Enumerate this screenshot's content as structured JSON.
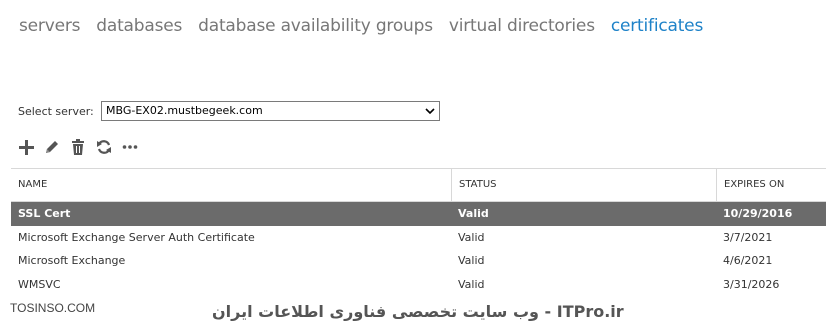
{
  "tabs": [
    {
      "label": "servers",
      "active": false
    },
    {
      "label": "databases",
      "active": false
    },
    {
      "label": "database availability groups",
      "active": false
    },
    {
      "label": "virtual directories",
      "active": false
    },
    {
      "label": "certificates",
      "active": true
    }
  ],
  "server_select": {
    "label": "Select server:",
    "value": "MBG-EX02.mustbegeek.com"
  },
  "toolbar": {
    "icons": [
      "add-icon",
      "edit-icon",
      "delete-icon",
      "refresh-icon",
      "more-icon"
    ]
  },
  "table": {
    "headers": [
      "NAME",
      "STATUS",
      "EXPIRES ON"
    ],
    "rows": [
      {
        "name": "SSL Cert",
        "status": "Valid",
        "expires": "10/29/2016",
        "selected": true
      },
      {
        "name": "Microsoft Exchange Server Auth Certificate",
        "status": "Valid",
        "expires": "3/7/2021",
        "selected": false
      },
      {
        "name": "Microsoft Exchange",
        "status": "Valid",
        "expires": "4/6/2021",
        "selected": false
      },
      {
        "name": "WMSVC",
        "status": "Valid",
        "expires": "3/31/2026",
        "selected": false
      }
    ]
  },
  "watermark": {
    "left": "TOSINSO.COM",
    "right": "ITPro.ir - وب سایت تخصصی فناوری اطلاعات ایران"
  },
  "colors": {
    "accent": "#1e82c8",
    "tab_inactive": "#777777",
    "selected_row": "#6b6b6b"
  }
}
